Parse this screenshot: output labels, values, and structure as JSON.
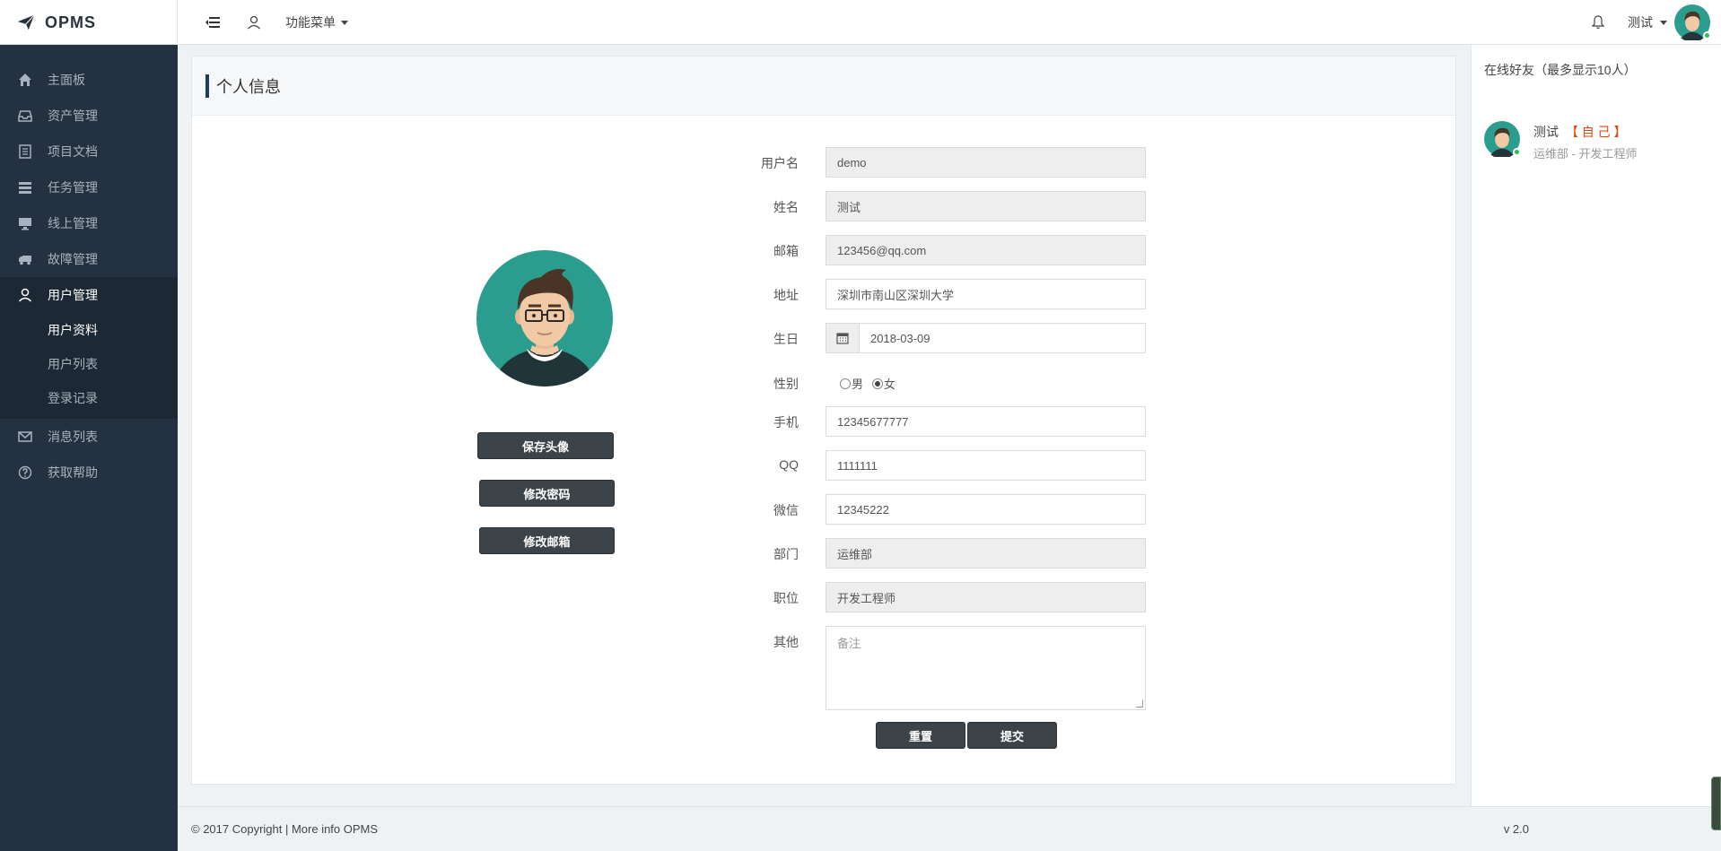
{
  "app": {
    "name": "OPMS"
  },
  "topbar": {
    "menu_label": "功能菜单",
    "user_name": "测试"
  },
  "sidebar": {
    "items": [
      {
        "label": "主面板",
        "icon": "home-icon"
      },
      {
        "label": "资产管理",
        "icon": "inbox-icon"
      },
      {
        "label": "项目文档",
        "icon": "document-icon"
      },
      {
        "label": "任务管理",
        "icon": "tasks-icon"
      },
      {
        "label": "线上管理",
        "icon": "monitor-icon"
      },
      {
        "label": "故障管理",
        "icon": "truck-icon"
      },
      {
        "label": "用户管理",
        "icon": "user-icon"
      },
      {
        "label": "消息列表",
        "icon": "mail-icon"
      },
      {
        "label": "获取帮助",
        "icon": "help-icon"
      }
    ],
    "submenu": [
      {
        "label": "用户资料"
      },
      {
        "label": "用户列表"
      },
      {
        "label": "登录记录"
      }
    ]
  },
  "page": {
    "title": "个人信息",
    "buttons": {
      "save_avatar": "保存头像",
      "change_password": "修改密码",
      "change_email": "修改邮箱",
      "reset": "重置",
      "submit": "提交"
    },
    "form": {
      "username": {
        "label": "用户名",
        "value": "demo"
      },
      "realname": {
        "label": "姓名",
        "value": "测试"
      },
      "email": {
        "label": "邮箱",
        "value": "123456@qq.com"
      },
      "address": {
        "label": "地址",
        "value": "深圳市南山区深圳大学"
      },
      "birthday": {
        "label": "生日",
        "value": "2018-03-09"
      },
      "gender": {
        "label": "性别",
        "options": [
          "男",
          "女"
        ],
        "selected": "女"
      },
      "phone": {
        "label": "手机",
        "value": "12345677777"
      },
      "qq": {
        "label": "QQ",
        "value": "1111111"
      },
      "wechat": {
        "label": "微信",
        "value": "12345222"
      },
      "department": {
        "label": "部门",
        "value": "运维部"
      },
      "position": {
        "label": "职位",
        "value": "开发工程师"
      },
      "other": {
        "label": "其他",
        "placeholder": "备注"
      }
    }
  },
  "rightbar": {
    "title": "在线好友（最多显示10人）",
    "friends": [
      {
        "name": "测试",
        "tag": "【 自 己 】",
        "sub": "运维部 - 开发工程师"
      }
    ]
  },
  "footer": {
    "copyright": "© 2017 Copyright | More info OPMS",
    "version": "v 2.0"
  },
  "colors": {
    "sidebar_bg": "#243140",
    "accent_bar": "#1c3b6e",
    "button_dark": "#3c4349",
    "self_tag": "#e5410b",
    "online": "#27c24c"
  }
}
